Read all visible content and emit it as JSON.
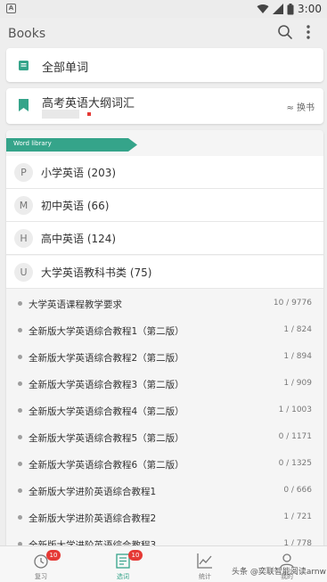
{
  "status_bar": {
    "time": "3:00",
    "app_icon_letter": "A"
  },
  "appbar": {
    "title": "Books"
  },
  "all_words": {
    "label": "全部单词"
  },
  "current_book": {
    "name": "高考英语大纲词汇",
    "switch_label": "≈ 换书"
  },
  "library": {
    "ribbon": "Word library",
    "categories": [
      {
        "letter": "P",
        "name": "小学英语 (203)"
      },
      {
        "letter": "M",
        "name": "初中英语 (66)"
      },
      {
        "letter": "H",
        "name": "高中英语 (124)"
      },
      {
        "letter": "U",
        "name": "大学英语教科书类 (75)"
      }
    ],
    "books": [
      {
        "name": "大学英语课程教学要求",
        "progress": "10 / 9776"
      },
      {
        "name": "全新版大学英语综合教程1（第二版）",
        "progress": "1 / 824"
      },
      {
        "name": "全新版大学英语综合教程2（第二版）",
        "progress": "1 / 894"
      },
      {
        "name": "全新版大学英语综合教程3（第二版）",
        "progress": "1 / 909"
      },
      {
        "name": "全新版大学英语综合教程4（第二版）",
        "progress": "1 / 1003"
      },
      {
        "name": "全新版大学英语综合教程5（第二版）",
        "progress": "0 / 1171"
      },
      {
        "name": "全新版大学英语综合教程6（第二版）",
        "progress": "0 / 1325"
      },
      {
        "name": "全新版大学进阶英语综合教程1",
        "progress": "0 / 666"
      },
      {
        "name": "全新版大学进阶英语综合教程2",
        "progress": "1 / 721"
      },
      {
        "name": "全新版大学进阶英语综合教程3",
        "progress": "1 / 778"
      }
    ]
  },
  "tabs": [
    {
      "label": "复习",
      "badge": "10"
    },
    {
      "label": "选词",
      "badge": "10"
    },
    {
      "label": "统计",
      "badge": ""
    },
    {
      "label": "我的",
      "badge": ""
    }
  ],
  "watermark": "头条 @奕联智能阅读arnw",
  "colors": {
    "accent": "#35a48a",
    "badge": "#e53935"
  }
}
